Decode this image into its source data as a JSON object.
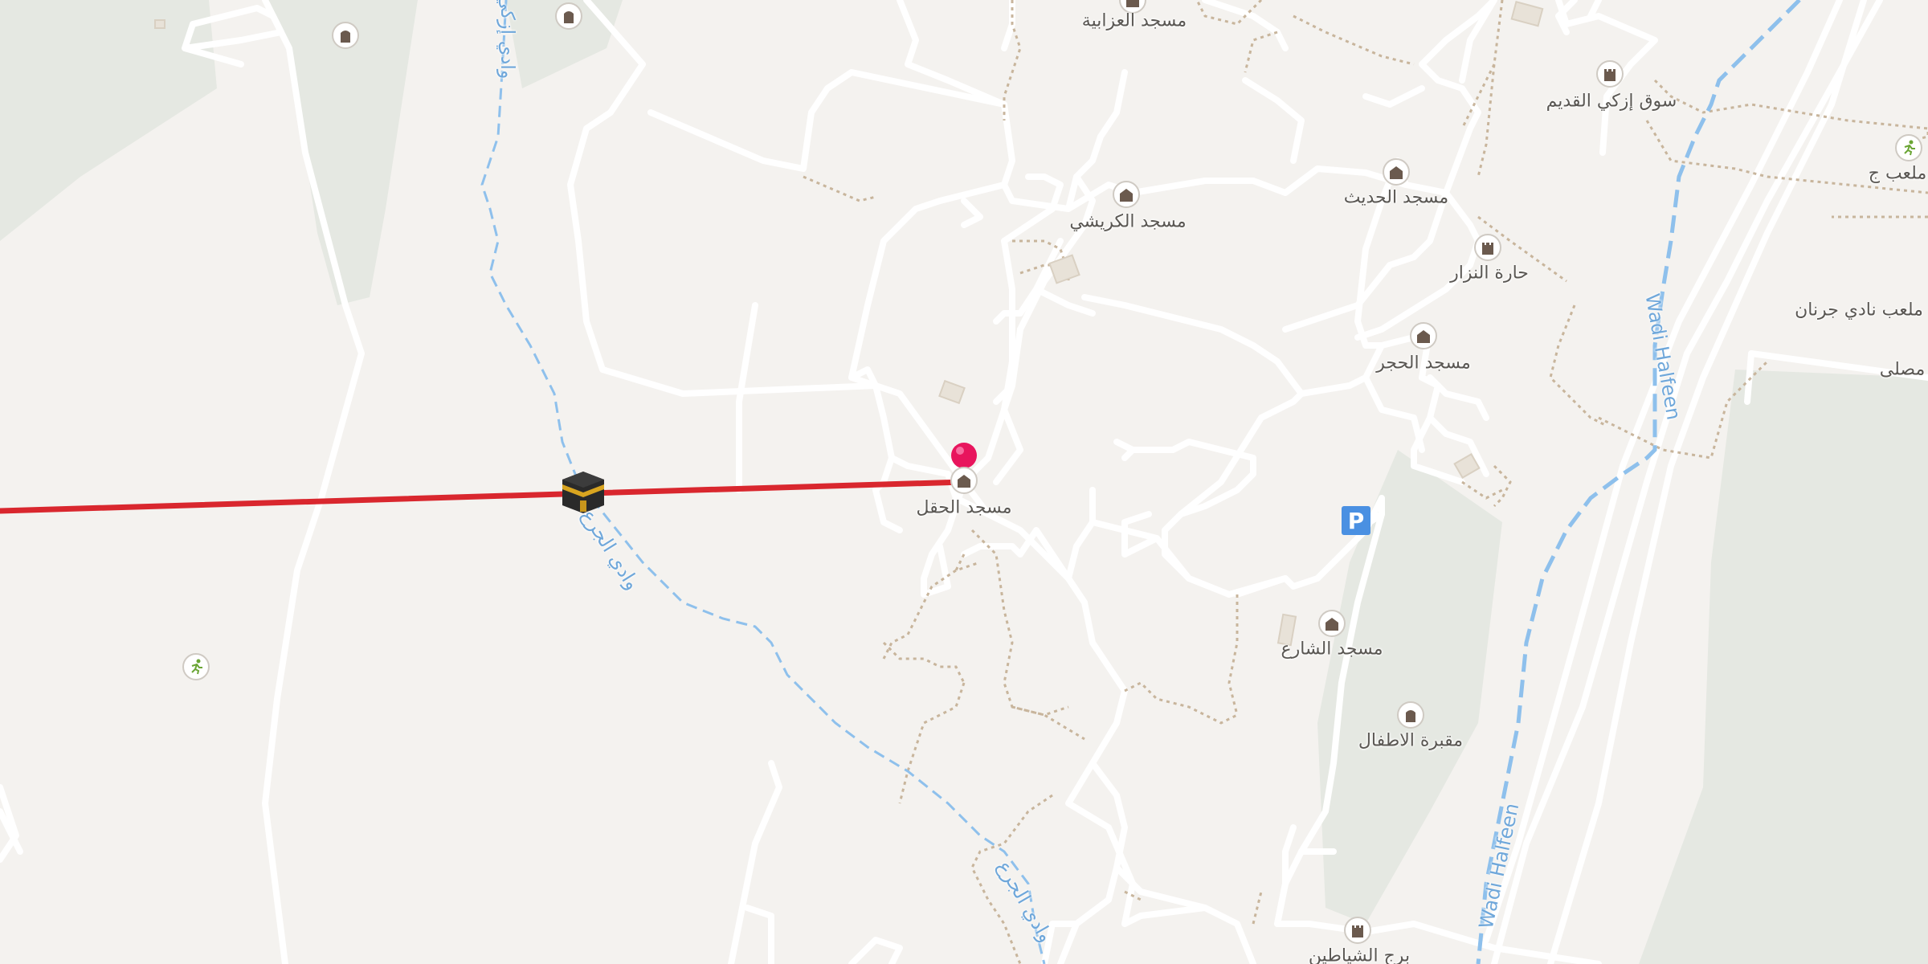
{
  "map": {
    "accent_route": "#d9272e",
    "marker_color": "#e8155d",
    "water_color": "#8ec0ec",
    "labels": {
      "mosque_azabiya": "مسجد العزابية",
      "mosque_karishi": "مسجد الكريشي",
      "mosque_hadith": "مسجد الحديث",
      "old_market": "سوق إزكي القديم",
      "nizar_quarter": "حارة النزار",
      "mosque_hajar": "مسجد الحجر",
      "mosque_haql": "مسجد الحقل",
      "mosque_sharia": "مسجد الشارع",
      "children_cemetery": "مقبرة الاطفال",
      "shayatin_tower": "برج الشياطين",
      "juran_club": "ملعب نادي جرنان",
      "playground_partial": "ملعب ج",
      "musalla_partial": "مصلى",
      "wadi_halfeen_1": "Wadi Halfeen",
      "wadi_halfeen_2": "Wadi Halfeen",
      "wadi_top": "وادي إزكي",
      "wadi_mid": "وادي الجرع",
      "wadi_low": "وادي الجرع"
    },
    "parking_label": "P"
  }
}
